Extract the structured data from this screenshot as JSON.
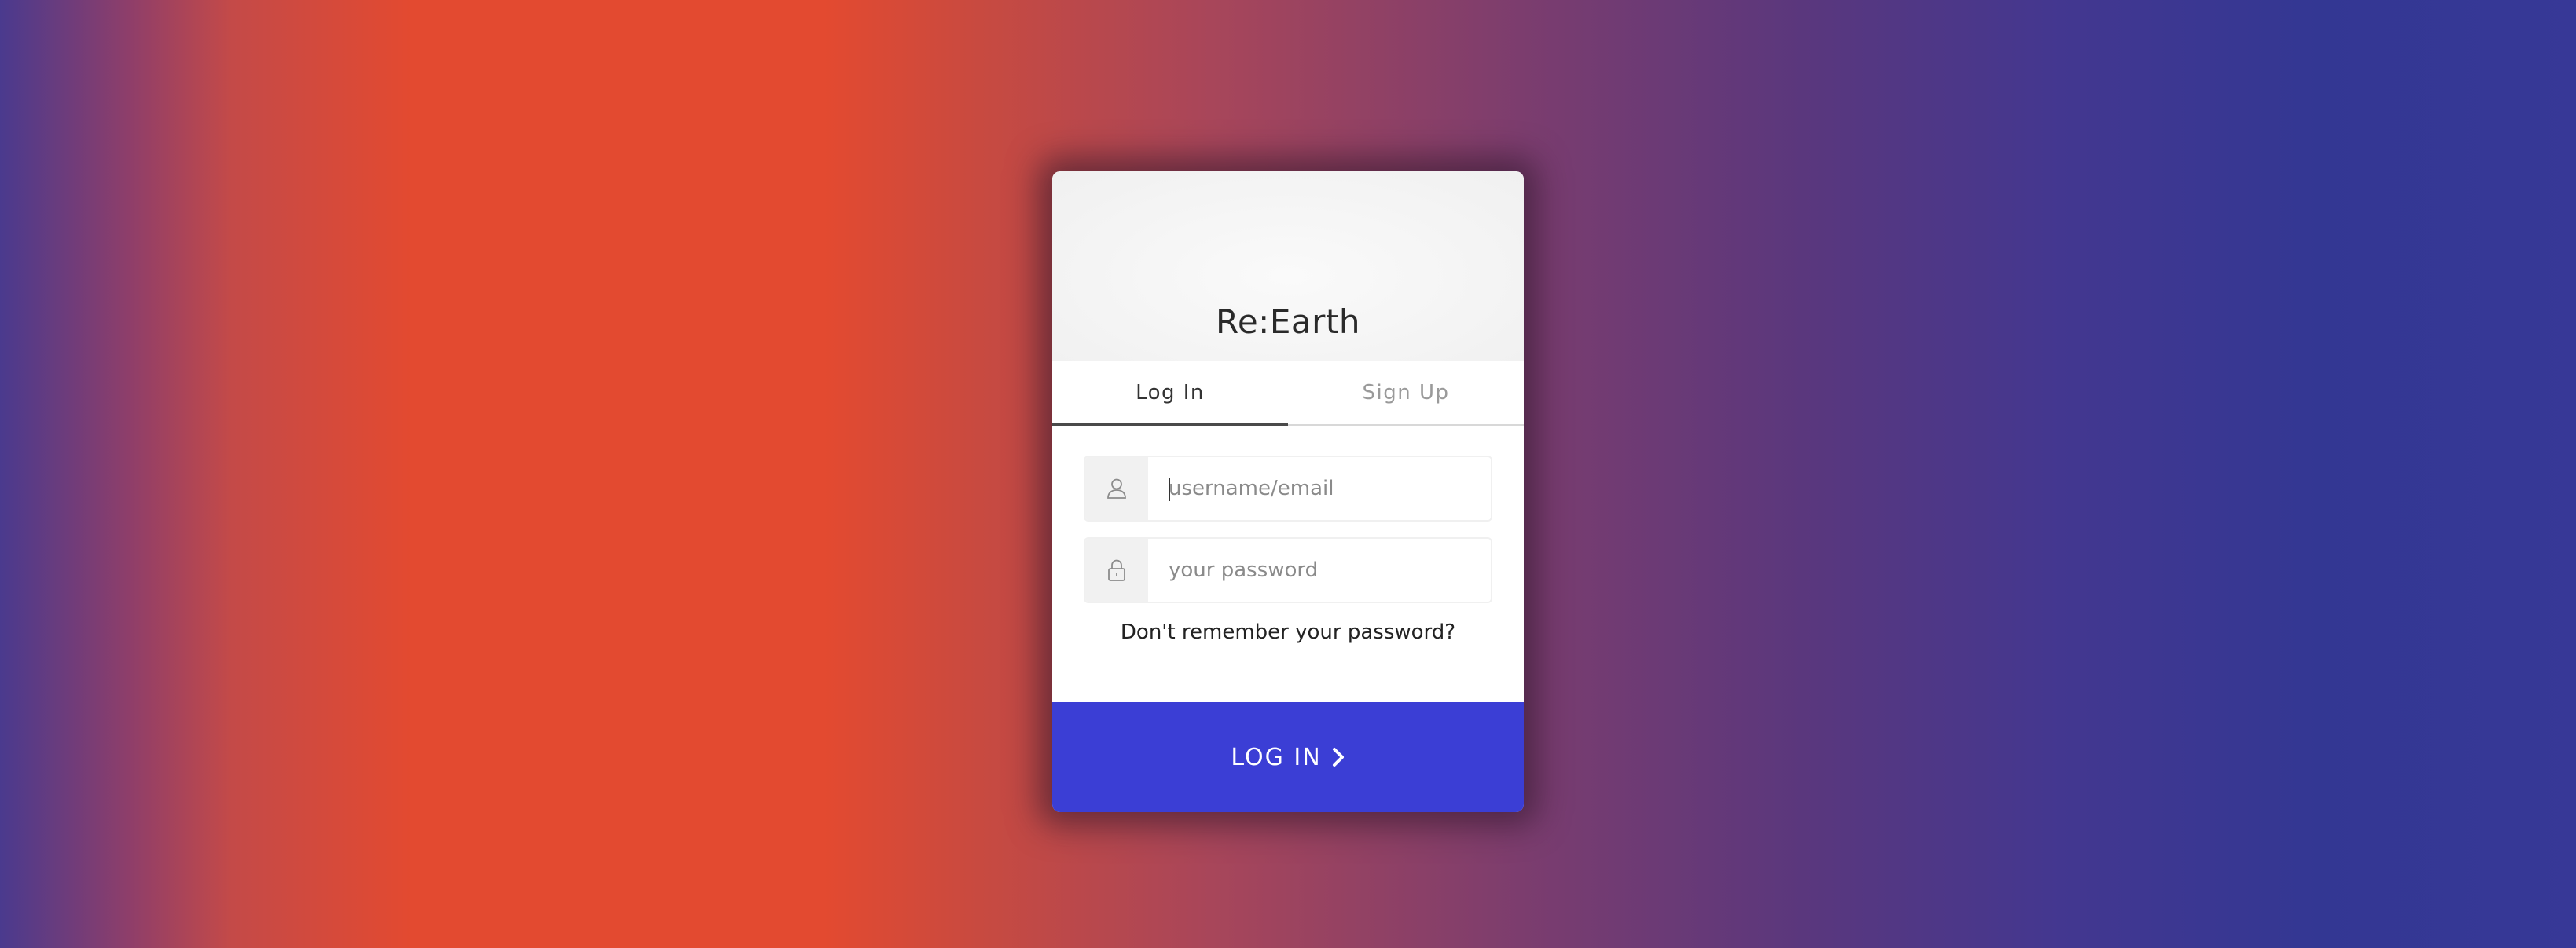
{
  "background": {
    "colors": [
      "#4a3a8e",
      "#e34a30",
      "#333793"
    ]
  },
  "card": {
    "app_title": "Re:Earth",
    "tabs": [
      {
        "label": "Log In",
        "active": true
      },
      {
        "label": "Sign Up",
        "active": false
      }
    ],
    "fields": {
      "username": {
        "placeholder": "username/email",
        "value": "",
        "icon": "user-icon"
      },
      "password": {
        "placeholder": "your password",
        "value": "",
        "icon": "lock-icon"
      }
    },
    "forgot_password_label": "Don't remember your password?",
    "submit": {
      "label": "LOG IN",
      "icon": "chevron-right-icon",
      "color": "#3b3ed5"
    }
  }
}
